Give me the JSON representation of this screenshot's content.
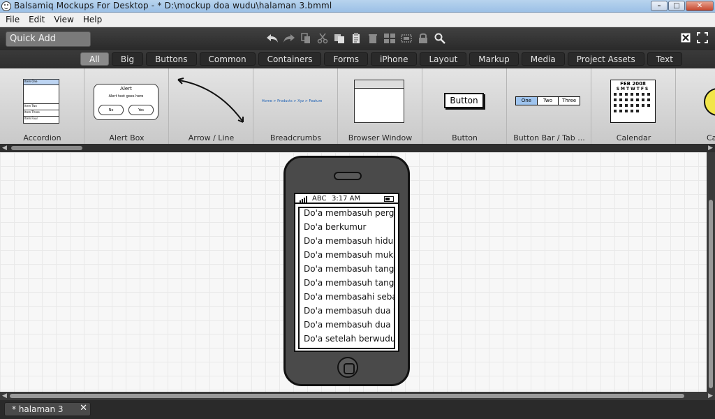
{
  "window": {
    "title": "Balsamiq Mockups For Desktop - * D:\\mockup doa wudu\\halaman 3.bmml",
    "minimize": "–",
    "maximize": "□",
    "close": "✕"
  },
  "menu": {
    "items": [
      "File",
      "Edit",
      "View",
      "Help"
    ]
  },
  "toolbar": {
    "quick_add_placeholder": "Quick Add",
    "icons": [
      "undo-icon",
      "redo-icon",
      "copy-icon",
      "cut-icon",
      "duplicate-icon",
      "paste-icon",
      "delete-icon",
      "group-icon",
      "lock-icon",
      "search-icon"
    ],
    "right_icons": [
      "close-mockup-icon",
      "fullscreen-icon"
    ]
  },
  "categories": {
    "items": [
      "All",
      "Big",
      "Buttons",
      "Common",
      "Containers",
      "Forms",
      "iPhone",
      "Layout",
      "Markup",
      "Media",
      "Project Assets",
      "Text"
    ],
    "active": "All"
  },
  "library": {
    "items": [
      "Accordion",
      "Alert Box",
      "Arrow / Line",
      "Breadcrumbs",
      "Browser Window",
      "Button",
      "Button Bar / Tab ...",
      "Calendar",
      "Ca"
    ],
    "accordion_rows": [
      "Item One",
      "Item Two",
      "Item Three",
      "Item Four"
    ],
    "alert_title": "Alert",
    "alert_text": "Alert text goes here",
    "alert_no": "No",
    "alert_yes": "Yes",
    "breadcrumb_text": "Home > Products > Xyz > Feature",
    "button_label": "Button",
    "buttonbar": [
      "One",
      "Two",
      "Three"
    ],
    "calendar_header": "FEB 2008",
    "calendar_days": "SMTWTFS"
  },
  "phone": {
    "carrier": "ABC",
    "time": "3:17 AM",
    "list": [
      "Do'a membasuh pergelangan",
      "Do'a berkumur",
      "Do'a membasuh hidung",
      "Do'a membasuh muka",
      "Do'a membasuh tangan",
      "Do'a membasuh tangan",
      "Do'a membasahi sebagian",
      "Do'a membasuh dua telinga",
      "Do'a membasuh dua kaki",
      "Do'a setelah berwudu"
    ]
  },
  "bottom": {
    "tab_label": "* halaman 3",
    "tab_close": "✕"
  },
  "colors": {
    "toolbar_bg": "#333333",
    "active_category": "#8a8a8a",
    "canvas_bg": "#f7f7f7"
  }
}
